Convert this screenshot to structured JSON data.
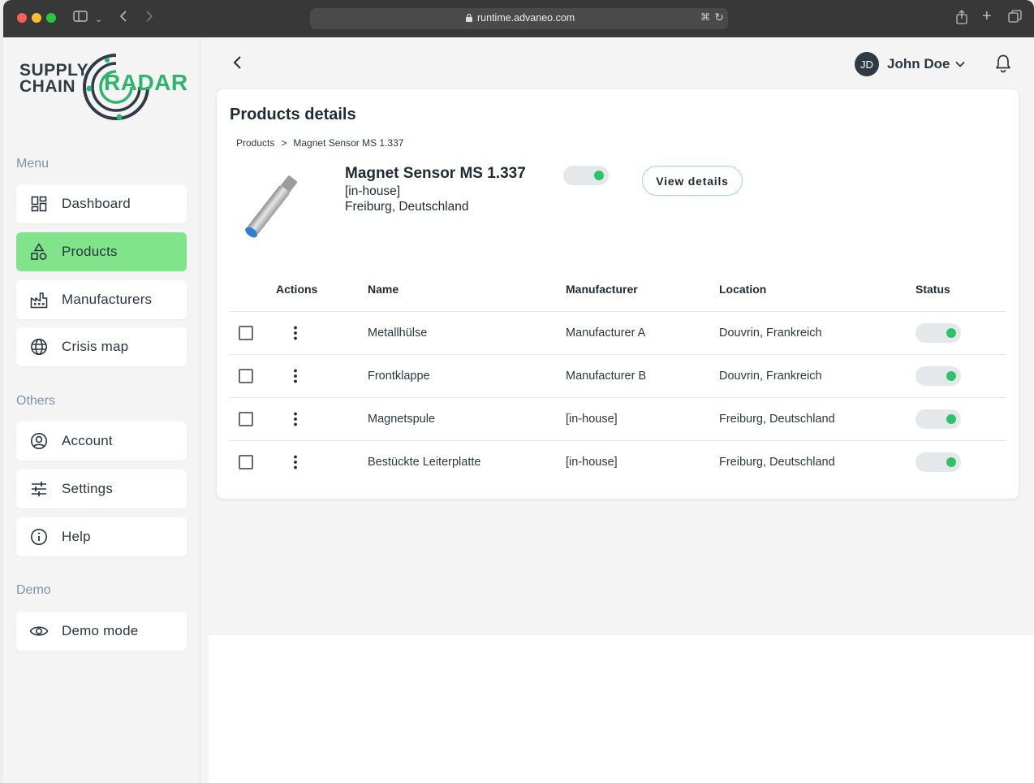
{
  "browser": {
    "url": "runtime.advaneo.com"
  },
  "logo": {
    "line1": "SUPPLY",
    "line2": "CHAIN",
    "accent": "RADAR"
  },
  "colors": {
    "brand_green": "#2db56a",
    "active_nav": "#80e48a",
    "status_on": "#2fc26a",
    "text_dark": "#1f2a33",
    "section_label": "#7d93aa"
  },
  "sidebar": {
    "menu_label": "Menu",
    "menu_items": [
      {
        "label": "Dashboard",
        "icon": "dashboard-icon",
        "active": false
      },
      {
        "label": "Products",
        "icon": "products-icon",
        "active": true
      },
      {
        "label": "Manufacturers",
        "icon": "factory-icon",
        "active": false
      },
      {
        "label": "Crisis map",
        "icon": "globe-icon",
        "active": false
      }
    ],
    "others_label": "Others",
    "others_items": [
      {
        "label": "Account",
        "icon": "account-icon"
      },
      {
        "label": "Settings",
        "icon": "sliders-icon"
      },
      {
        "label": "Help",
        "icon": "info-icon"
      }
    ],
    "demo_label": "Demo",
    "demo_items": [
      {
        "label": "Demo mode",
        "icon": "eye-icon"
      }
    ]
  },
  "header": {
    "user_initials": "JD",
    "user_name": "John Doe"
  },
  "page": {
    "title": "Products details",
    "breadcrumb": [
      "Products",
      ">",
      "Magnet Sensor MS 1.337"
    ]
  },
  "product": {
    "name": "Magnet Sensor MS 1.337",
    "source": "[in-house]",
    "location": "Freiburg, Deutschland",
    "active": true,
    "view_details_label": "View details"
  },
  "table": {
    "columns": [
      "Actions",
      "Name",
      "Manufacturer",
      "Location",
      "Status"
    ],
    "rows": [
      {
        "name": "Metallhülse",
        "manufacturer": "Manufacturer A",
        "location": "Douvrin, Frankreich",
        "status": true
      },
      {
        "name": "Frontklappe",
        "manufacturer": "Manufacturer B",
        "location": "Douvrin, Frankreich",
        "status": true
      },
      {
        "name": "Magnetspule",
        "manufacturer": "[in-house]",
        "location": "Freiburg, Deutschland",
        "status": true
      },
      {
        "name": "Bestückte Leiterplatte",
        "manufacturer": "[in-house]",
        "location": "Freiburg, Deutschland",
        "status": true
      }
    ]
  }
}
